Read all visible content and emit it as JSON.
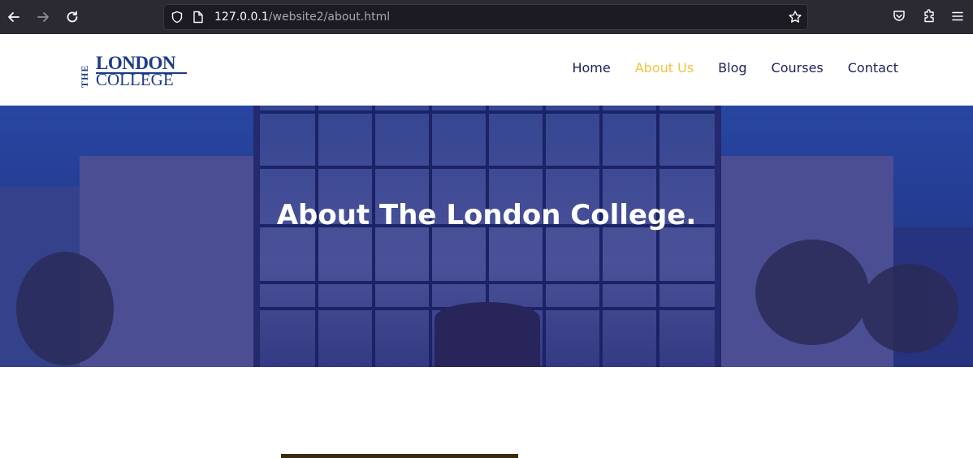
{
  "browser": {
    "url_host": "127.0.0.1",
    "url_path": "/website2/about.html"
  },
  "site": {
    "logo": {
      "the": "THE",
      "line1": "LONDON",
      "line2": "COLLEGE"
    },
    "nav": [
      {
        "label": "Home",
        "active": false
      },
      {
        "label": "About Us",
        "active": true
      },
      {
        "label": "Blog",
        "active": false
      },
      {
        "label": "Courses",
        "active": false
      },
      {
        "label": "Contact",
        "active": false
      }
    ],
    "colors": {
      "brand": "#1b3a8c",
      "nav_text": "#1e1f5c",
      "nav_active": "#f6c23c",
      "hero_overlay": "#24347f"
    }
  },
  "hero": {
    "title": "About The London College."
  }
}
